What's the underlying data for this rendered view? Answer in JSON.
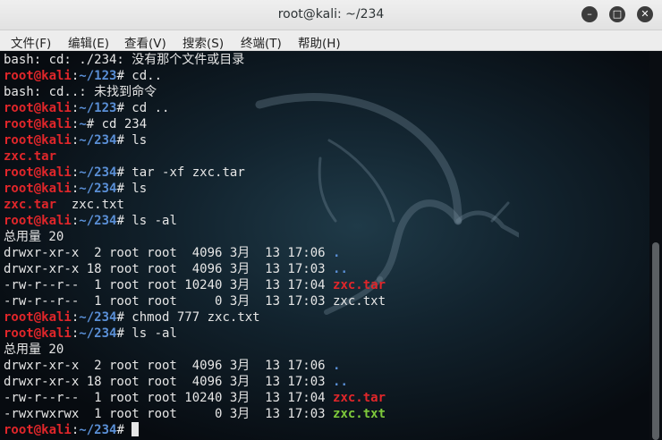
{
  "window": {
    "title": "root@kali: ~/234"
  },
  "menu": [
    "文件(F)",
    "编辑(E)",
    "查看(V)",
    "搜索(S)",
    "终端(T)",
    "帮助(H)"
  ],
  "terminal": {
    "lines": [
      [
        {
          "t": "bash: cd: ./234: 没有那个文件或目录",
          "c": "w"
        }
      ],
      [
        {
          "t": "root@kali",
          "c": "r"
        },
        {
          "t": ":",
          "c": "w"
        },
        {
          "t": "~/123",
          "c": "b"
        },
        {
          "t": "# cd..",
          "c": "w"
        }
      ],
      [
        {
          "t": "bash: cd..: 未找到命令",
          "c": "w"
        }
      ],
      [
        {
          "t": "root@kali",
          "c": "r"
        },
        {
          "t": ":",
          "c": "w"
        },
        {
          "t": "~/123",
          "c": "b"
        },
        {
          "t": "# cd ..",
          "c": "w"
        }
      ],
      [
        {
          "t": "root@kali",
          "c": "r"
        },
        {
          "t": ":",
          "c": "w"
        },
        {
          "t": "~",
          "c": "b"
        },
        {
          "t": "# cd 234",
          "c": "w"
        }
      ],
      [
        {
          "t": "root@kali",
          "c": "r"
        },
        {
          "t": ":",
          "c": "w"
        },
        {
          "t": "~/234",
          "c": "b"
        },
        {
          "t": "# ls",
          "c": "w"
        }
      ],
      [
        {
          "t": "zxc.tar",
          "c": "r"
        }
      ],
      [
        {
          "t": "root@kali",
          "c": "r"
        },
        {
          "t": ":",
          "c": "w"
        },
        {
          "t": "~/234",
          "c": "b"
        },
        {
          "t": "# tar -xf zxc.tar",
          "c": "w"
        }
      ],
      [
        {
          "t": "root@kali",
          "c": "r"
        },
        {
          "t": ":",
          "c": "w"
        },
        {
          "t": "~/234",
          "c": "b"
        },
        {
          "t": "# ls",
          "c": "w"
        }
      ],
      [
        {
          "t": "zxc.tar",
          "c": "r"
        },
        {
          "t": "  zxc.txt",
          "c": "w"
        }
      ],
      [
        {
          "t": "root@kali",
          "c": "r"
        },
        {
          "t": ":",
          "c": "w"
        },
        {
          "t": "~/234",
          "c": "b"
        },
        {
          "t": "# ls -al",
          "c": "w"
        }
      ],
      [
        {
          "t": "总用量 20",
          "c": "w"
        }
      ],
      [
        {
          "t": "drwxr-xr-x  2 root root  4096 3月  13 17:06 ",
          "c": "w"
        },
        {
          "t": ".",
          "c": "b"
        }
      ],
      [
        {
          "t": "drwxr-xr-x 18 root root  4096 3月  13 17:03 ",
          "c": "w"
        },
        {
          "t": "..",
          "c": "b"
        }
      ],
      [
        {
          "t": "-rw-r--r--  1 root root 10240 3月  13 17:04 ",
          "c": "w"
        },
        {
          "t": "zxc.tar",
          "c": "r"
        }
      ],
      [
        {
          "t": "-rw-r--r--  1 root root     0 3月  13 17:03 zxc.txt",
          "c": "w"
        }
      ],
      [
        {
          "t": "root@kali",
          "c": "r"
        },
        {
          "t": ":",
          "c": "w"
        },
        {
          "t": "~/234",
          "c": "b"
        },
        {
          "t": "# chmod 777 zxc.txt",
          "c": "w"
        }
      ],
      [
        {
          "t": "root@kali",
          "c": "r"
        },
        {
          "t": ":",
          "c": "w"
        },
        {
          "t": "~/234",
          "c": "b"
        },
        {
          "t": "# ls -al",
          "c": "w"
        }
      ],
      [
        {
          "t": "总用量 20",
          "c": "w"
        }
      ],
      [
        {
          "t": "drwxr-xr-x  2 root root  4096 3月  13 17:06 ",
          "c": "w"
        },
        {
          "t": ".",
          "c": "b"
        }
      ],
      [
        {
          "t": "drwxr-xr-x 18 root root  4096 3月  13 17:03 ",
          "c": "w"
        },
        {
          "t": "..",
          "c": "b"
        }
      ],
      [
        {
          "t": "-rw-r--r--  1 root root 10240 3月  13 17:04 ",
          "c": "w"
        },
        {
          "t": "zxc.tar",
          "c": "r"
        }
      ],
      [
        {
          "t": "-rwxrwxrwx  1 root root     0 3月  13 17:03 ",
          "c": "w"
        },
        {
          "t": "zxc.txt",
          "c": "g"
        }
      ],
      [
        {
          "t": "root@kali",
          "c": "r"
        },
        {
          "t": ":",
          "c": "w"
        },
        {
          "t": "~/234",
          "c": "b"
        },
        {
          "t": "# ",
          "c": "w"
        }
      ]
    ]
  },
  "colors": {
    "prompt_user": "#e0262a",
    "prompt_path": "#5a8fd6",
    "exec_file": "#7ec93b",
    "background": "#0b0f14"
  }
}
